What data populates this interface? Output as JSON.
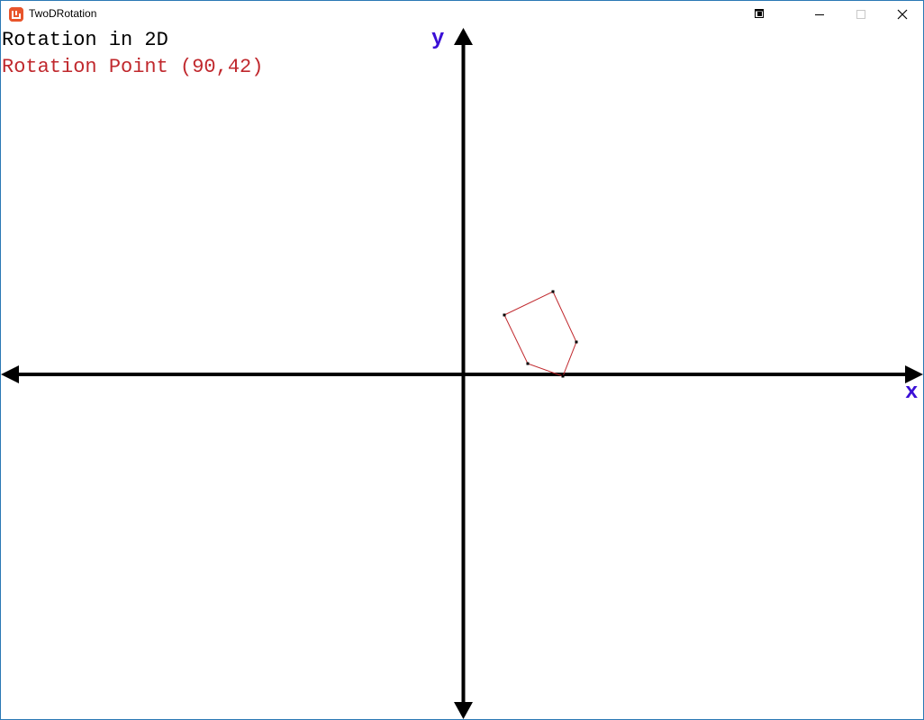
{
  "window": {
    "title": "TwoDRotation"
  },
  "overlay": {
    "heading": "Rotation in 2D",
    "rotation_point_text": "Rotation Point (90,42)",
    "rotation_point_color": "#c0282d"
  },
  "axes": {
    "x_label": "x",
    "y_label": "y",
    "label_color": "#3a0fd6",
    "axis_color": "#000000"
  },
  "polygon": {
    "stroke_color": "#c0282d",
    "vertex_color": "#000000"
  },
  "icons": {
    "app": "monogame-icon",
    "special": "restore-window-icon",
    "minimize": "minimize-icon",
    "maximize": "maximize-icon",
    "close": "close-icon"
  }
}
